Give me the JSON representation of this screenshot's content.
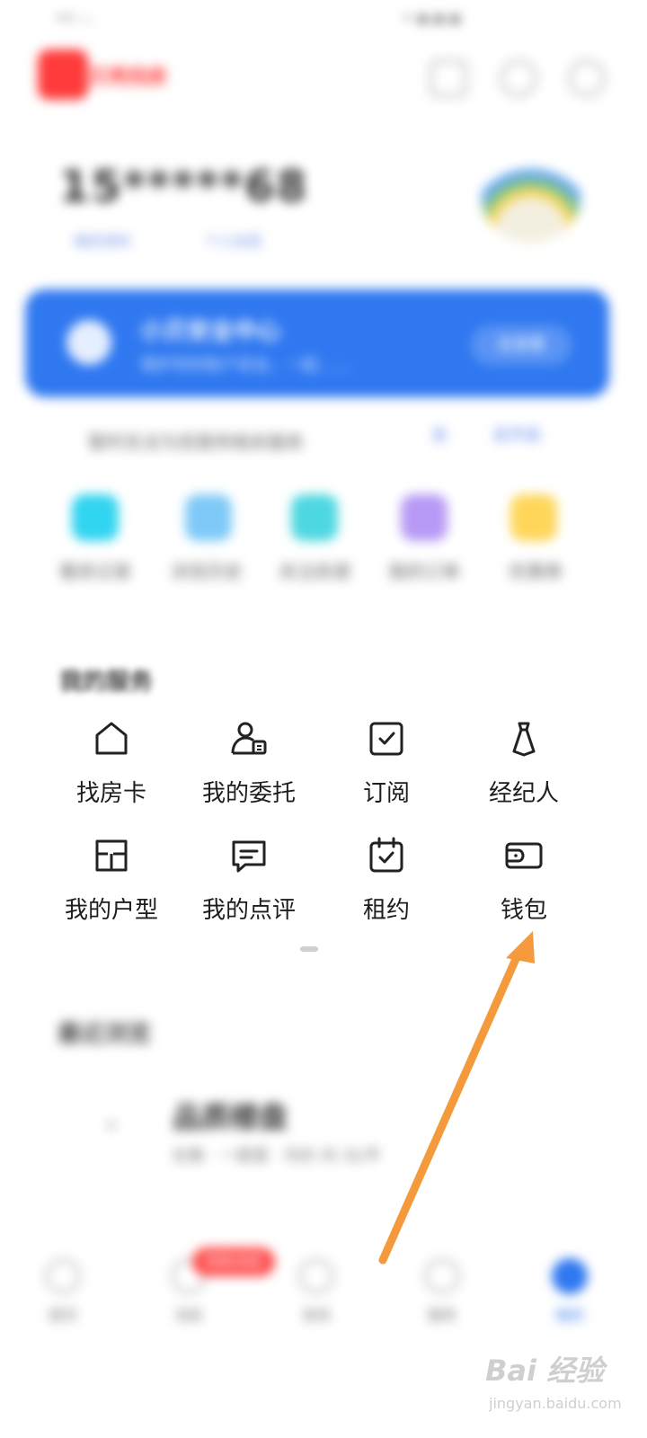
{
  "status_bar": {
    "left_text": "•• ᵢ ᵢ",
    "right_text": "• ▪ ▪ ▪"
  },
  "header": {
    "brand_name": "贝壳找房"
  },
  "profile": {
    "phone_masked": "15*****68",
    "link_a": "我的资料",
    "link_b": "个人信息"
  },
  "banner": {
    "title": "小贝安全中心",
    "subtitle": "保护你的账户安全，一起……",
    "button": "去查看"
  },
  "notice": {
    "text": "暂时无法为您提供相关服务",
    "link_a": "去",
    "link_b": "去开启"
  },
  "shortcuts": [
    {
      "label": "看房记录",
      "color": "#31d4f0"
    },
    {
      "label": "浏览历史",
      "color": "#7ec9f7"
    },
    {
      "label": "关注房源",
      "color": "#4dd7e0"
    },
    {
      "label": "我的订单",
      "color": "#b79af5"
    },
    {
      "label": "优惠券",
      "color": "#ffd65a"
    }
  ],
  "services": {
    "title": "我的服务",
    "items": [
      {
        "label": "找房卡",
        "icon": "house-icon"
      },
      {
        "label": "我的委托",
        "icon": "delegate-icon"
      },
      {
        "label": "订阅",
        "icon": "subscribe-icon"
      },
      {
        "label": "经纪人",
        "icon": "agent-icon"
      },
      {
        "label": "我的户型",
        "icon": "floorplan-icon"
      },
      {
        "label": "我的点评",
        "icon": "comment-icon"
      },
      {
        "label": "租约",
        "icon": "lease-icon"
      },
      {
        "label": "钱包",
        "icon": "wallet-icon"
      }
    ]
  },
  "recent": {
    "title": "最近浏览",
    "name": "品质楼盘",
    "meta": "在售 · 一居室 · 均价 约 元/平"
  },
  "bottom_nav": {
    "items": [
      {
        "label": "首页"
      },
      {
        "label": "消息"
      },
      {
        "label": "发现"
      },
      {
        "label": "服务"
      },
      {
        "label": "我的"
      }
    ],
    "badge": "有新消息"
  },
  "annotation": {
    "arrow_color": "#f49a3c"
  },
  "watermark": {
    "main": "Bai 经验",
    "sub": "jingyan.baidu.com"
  }
}
